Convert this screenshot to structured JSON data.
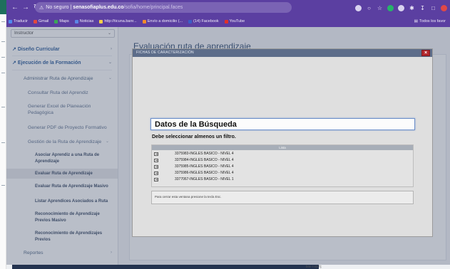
{
  "browser": {
    "security_label": "No seguro",
    "host": "senasofiaplus.edu.co",
    "path": "/sofia/home/principal.faces",
    "bookmarks": [
      {
        "label": "Traducir",
        "color": "#4f8bf0"
      },
      {
        "label": "Gmail",
        "color": "#e2493d"
      },
      {
        "label": "Maps",
        "color": "#3aa757"
      },
      {
        "label": "Noticias",
        "color": "#5b86e5"
      },
      {
        "label": "http://ticuna.banr...",
        "color": "#f5d048"
      },
      {
        "label": "Envío a domicilio (...",
        "color": "#f58a2a"
      },
      {
        "label": "(14) Facebook",
        "color": "#3b5ec6"
      },
      {
        "label": "YouTube",
        "color": "#e0302a"
      }
    ],
    "other_bookmarks": "Todos los favor"
  },
  "sidebar": {
    "role_select": "Instructor",
    "items": [
      {
        "label": "Diseño Curricular"
      },
      {
        "label": "Ejecución de la Formación"
      },
      {
        "label": "Administrar Ruta de Aprendizaje"
      },
      {
        "label": "Consultar Ruta del Aprendiz"
      },
      {
        "label": "Generar Excel de Planeación"
      },
      {
        "label": "Pedagógica"
      },
      {
        "label": "Generar PDF de Proyecto Formativo"
      },
      {
        "label": "Gestión de la Ruta de Aprendizaje"
      },
      {
        "label": "Asociar Aprendiz a una Ruta de"
      },
      {
        "label": "Aprendizaje"
      },
      {
        "label": "Evaluar Ruta de Aprendizaje"
      },
      {
        "label": "Evaluar Ruta de Aprendizaje Masivo"
      },
      {
        "label": "Listar Aprendices Asociados a Ruta"
      },
      {
        "label": "Reconocimiento de Aprendizaje"
      },
      {
        "label": "Previos Masivo"
      },
      {
        "label": "Reconocimiento de Aprendizajes"
      },
      {
        "label": "Previos"
      },
      {
        "label": "Reportes"
      }
    ]
  },
  "main": {
    "title": "Evaluación ruta de aprendizaje"
  },
  "modal": {
    "title": "FICHAS DE CARACTERIZACIÓN",
    "close": "×",
    "search_heading": "Datos de la Búsqueda",
    "filter_message": "Debe seleccionar almenos un filtro.",
    "list_header": "Lista",
    "rows": [
      "3375983-INGLES BASICO - NIVEL 4",
      "3375984-INGLES BASICO - NIVEL 4",
      "3375985-INGLES BASICO - NIVEL 4",
      "3375986-INGLES BASICO - NIVEL 4",
      "3377067-INGLES BASICO - NIVEL 1"
    ],
    "close_hint": "Para cerrar esta ventana presione la tecla Esc."
  },
  "status": {
    "tail": "bra- t-a17);"
  },
  "colors": {
    "browser_chrome": "#5b3fa1",
    "modal_titlebar": "#5d6d8a",
    "close_button": "#b3262c",
    "sidebar_heading": "#2c5d9c"
  }
}
